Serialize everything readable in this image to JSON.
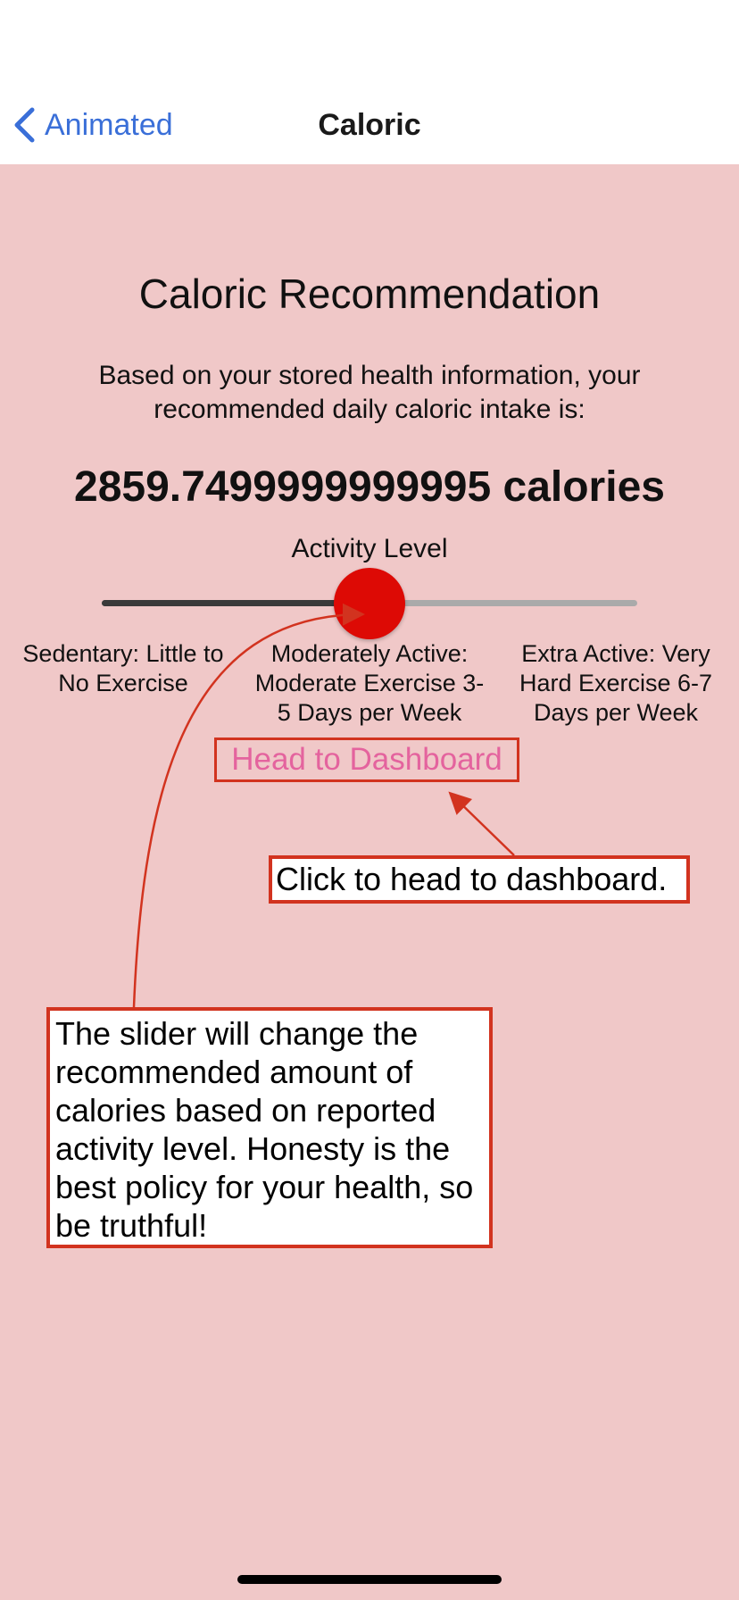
{
  "navbar": {
    "back_label": "Animated",
    "back_icon": "chevron-left-icon",
    "title": "Caloric"
  },
  "main": {
    "title": "Caloric Recommendation",
    "subtitle": "Based on your stored health information, your recommended daily caloric intake is:",
    "calories": "2859.7499999999995 calories",
    "activity_label": "Activity Level",
    "slider_value": 0.5,
    "levels": [
      "Sedentary: Little to No Exercise",
      "Moderately Active: Moderate Exercise 3-5 Days per Week",
      "Extra Active: Very Hard Exercise 6-7 Days per Week"
    ],
    "dashboard_button": "Head to Dashboard"
  },
  "annotations": {
    "dashboard_note": "Click to head to dashboard.",
    "slider_note": "The slider will change the recommended amount of calories based on reported activity level. Honesty is the best policy for your health, so be truthful!"
  },
  "colors": {
    "background": "#f0c8c8",
    "accent_blue": "#3a6fd8",
    "thumb_red": "#dd0a05",
    "button_pink": "#e4639e",
    "annotation_red": "#d2331f"
  }
}
